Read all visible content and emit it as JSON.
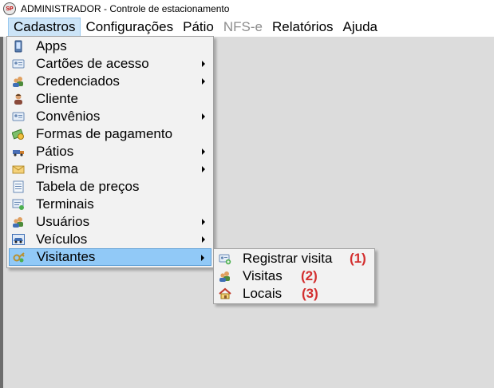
{
  "window": {
    "title": "ADMINISTRADOR - Controle de estacionamento",
    "icon": "parking-app-icon",
    "icon_text": "SP"
  },
  "menubar": {
    "items": [
      {
        "label": "Cadastros",
        "state": "open"
      },
      {
        "label": "Configurações",
        "state": "normal"
      },
      {
        "label": "Pátio",
        "state": "normal"
      },
      {
        "label": "NFS-e",
        "state": "disabled"
      },
      {
        "label": "Relatórios",
        "state": "normal"
      },
      {
        "label": "Ajuda",
        "state": "normal"
      }
    ]
  },
  "cadastros_menu": {
    "items": [
      {
        "label": "Apps",
        "icon": "mobile-phone-icon",
        "submenu": false
      },
      {
        "label": "Cartões de acesso",
        "icon": "id-card-icon",
        "submenu": true
      },
      {
        "label": "Credenciados",
        "icon": "users-icon",
        "submenu": true
      },
      {
        "label": "Cliente",
        "icon": "person-icon",
        "submenu": false
      },
      {
        "label": "Convênios",
        "icon": "id-card-icon",
        "submenu": true
      },
      {
        "label": "Formas de pagamento",
        "icon": "money-icon",
        "submenu": false
      },
      {
        "label": "Pátios",
        "icon": "truck-icon",
        "submenu": true
      },
      {
        "label": "Prisma",
        "icon": "envelope-icon",
        "submenu": true
      },
      {
        "label": "Tabela de preços",
        "icon": "price-table-icon",
        "submenu": false
      },
      {
        "label": "Terminais",
        "icon": "terminal-icon",
        "submenu": false
      },
      {
        "label": "Usuários",
        "icon": "users-icon",
        "submenu": true
      },
      {
        "label": "Veículos",
        "icon": "car-icon",
        "submenu": true
      },
      {
        "label": "Visitantes",
        "icon": "key-icon",
        "submenu": true,
        "highlighted": true
      }
    ]
  },
  "visitantes_submenu": {
    "items": [
      {
        "label": "Registrar visita",
        "icon": "id-card-add-icon",
        "badge": "(1)"
      },
      {
        "label": "Visitas",
        "icon": "users-icon",
        "badge": "(2)"
      },
      {
        "label": "Locais",
        "icon": "house-icon",
        "badge": "(3)"
      }
    ]
  },
  "colors": {
    "highlight": "#91c9f7",
    "menu_open": "#cce4f7",
    "badge": "#d32f2f",
    "client_area": "#dcdcdc"
  }
}
